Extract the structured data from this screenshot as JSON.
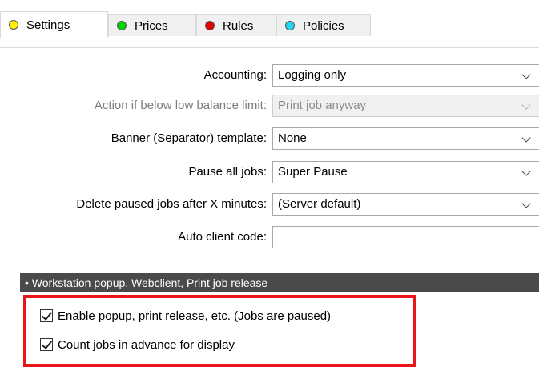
{
  "tabs": [
    {
      "label": "Settings",
      "color": "#fff200",
      "active": true
    },
    {
      "label": "Prices",
      "color": "#00d400"
    },
    {
      "label": "Rules",
      "color": "#e80000"
    },
    {
      "label": "Policies",
      "color": "#22d8f0"
    }
  ],
  "form": {
    "accounting": {
      "label": "Accounting:",
      "value": "Logging only"
    },
    "low_balance": {
      "label": "Action if below low balance limit:",
      "value": "Print job anyway",
      "disabled": true
    },
    "banner": {
      "label": "Banner (Separator) template:",
      "value": "None"
    },
    "pause": {
      "label": "Pause all jobs:",
      "value": "Super Pause"
    },
    "delete_paused": {
      "label": "Delete paused jobs after X minutes:",
      "value": "(Server default)"
    },
    "auto_client": {
      "label": "Auto client code:",
      "value": ""
    }
  },
  "section": {
    "title": "• Workstation popup, Webclient, Print job release"
  },
  "checkboxes": [
    {
      "label": "Enable popup, print release, etc. (Jobs are paused)",
      "checked": true
    },
    {
      "label": "Count jobs in advance for display",
      "checked": true
    }
  ],
  "colors": {
    "highlight": "#e8151b",
    "section_bg": "#4a4a4a"
  }
}
